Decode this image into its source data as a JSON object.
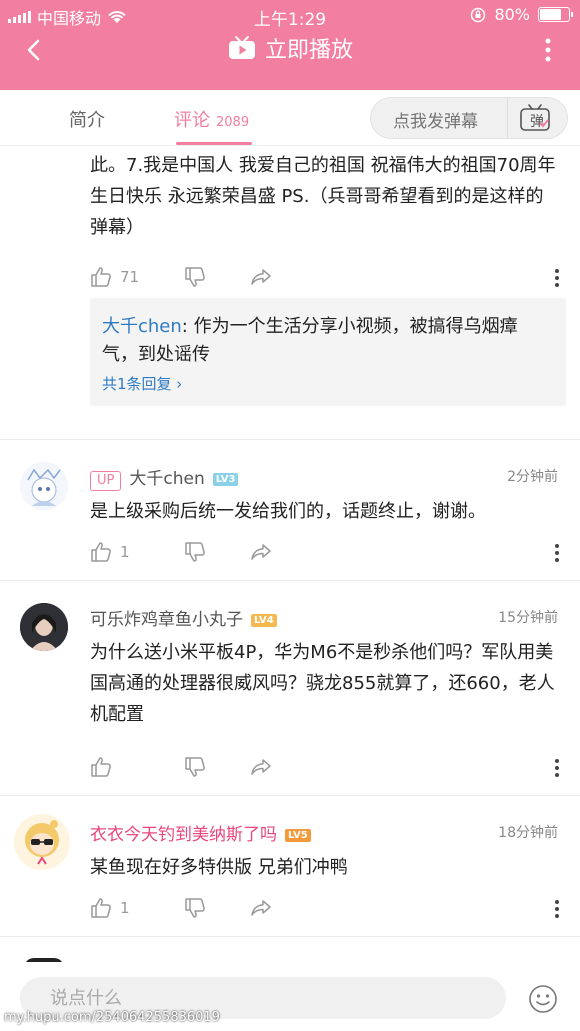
{
  "status_bar": {
    "carrier": "中国移动",
    "time": "上午1:29",
    "battery": "80%",
    "battery_level": 0.8
  },
  "nav": {
    "title": "立即播放",
    "icons": [
      "back-arrow-icon",
      "tv-play-icon",
      "more-vert-icon"
    ]
  },
  "tabs": {
    "intro": "简介",
    "comments": "评论",
    "comments_count": "2089"
  },
  "danmaku": {
    "label": "点我发弹幕",
    "icon_text": "弹"
  },
  "comments": [
    {
      "text": "此。7.我是中国人 我爱自己的祖国 祝福伟大的祖国70周年生日快乐  永远繁荣昌盛 PS.（兵哥哥希望看到的是这样的弹幕）",
      "likes": "71",
      "reply": {
        "user": "大千chen",
        "sep": ": ",
        "text": "作为一个生活分享小视频，被搞得乌烟瘴气，到处谣传",
        "more": "共1条回复 ›"
      }
    },
    {
      "badge": "UP",
      "name": "大千chen",
      "level": "LV3",
      "level_color": "#8ad0e6",
      "time": "2分钟前",
      "text": "是上级采购后统一发给我们的，话题终止，谢谢。",
      "likes": "1"
    },
    {
      "name": "可乐炸鸡章鱼小丸子",
      "level": "LV4",
      "level_color": "#f5b950",
      "time": "15分钟前",
      "text": "为什么送小米平板4P，华为M6不是秒杀他们吗？军队用美国高通的处理器很威风吗？骁龙855就算了，还660，老人机配置",
      "likes": ""
    },
    {
      "name": "衣衣今天钓到美纳斯了吗",
      "name_color": "#e8467c",
      "level": "LV5",
      "level_color": "#f39a3c",
      "time": "18分钟前",
      "text": "某鱼现在好多特供版 兄弟们冲鸭",
      "likes": "1"
    }
  ],
  "input": {
    "placeholder": "说点什么"
  },
  "watermark": "my.hupu.com/254064255836019"
}
